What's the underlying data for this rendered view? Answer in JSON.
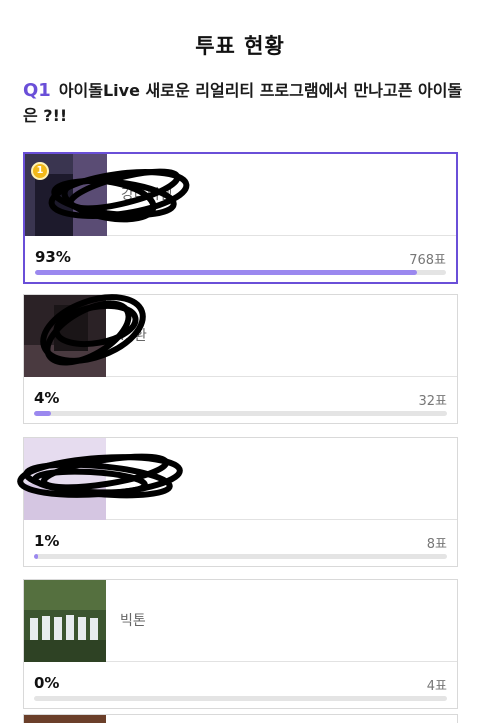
{
  "header": {
    "title": "투표 현황"
  },
  "question": {
    "number": "Q1",
    "text": "아이돌Live 새로운 리얼리티 프로그램에서 만나고픈 아이돌은 ?!!"
  },
  "candidates": [
    {
      "rank": "1",
      "name": "강다니엘",
      "percent_label": "93%",
      "votes_label": "768표",
      "share": 0.93,
      "thumb_color": "#3a3550",
      "scribble": true
    },
    {
      "name": "…환",
      "percent_label": "4%",
      "votes_label": "32표",
      "share": 0.04,
      "thumb_color": "#2b2226",
      "scribble": true
    },
    {
      "name": "",
      "percent_label": "1%",
      "votes_label": "8표",
      "share": 0.01,
      "thumb_color": "#e6dcef",
      "scribble": true
    },
    {
      "name": "빅톤",
      "percent_label": "0%",
      "votes_label": "4표",
      "share": 0.0,
      "thumb_color": "#3c5530",
      "scribble": false
    }
  ],
  "colors": {
    "accent": "#6a4fd8",
    "bar_fill": "#9b88ef",
    "bar_track": "#e4e4e4",
    "badge_gold": "#f2b81a"
  }
}
